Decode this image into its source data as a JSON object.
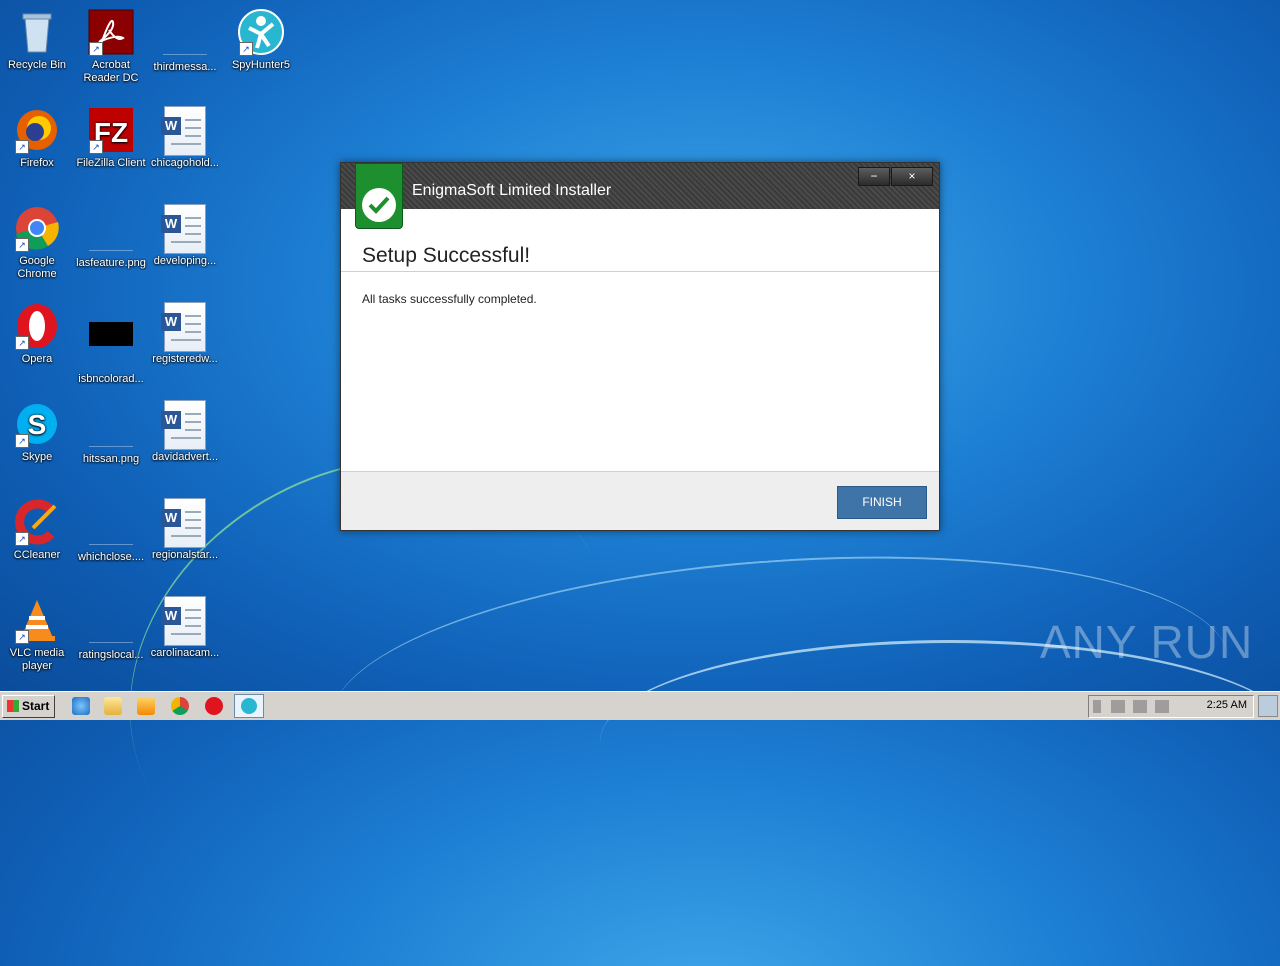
{
  "desktop": {
    "icons": [
      {
        "label": "Recycle Bin"
      },
      {
        "label": "Acrobat Reader DC"
      },
      {
        "label": "thirdmessa..."
      },
      {
        "label": "SpyHunter5"
      },
      {
        "label": "Firefox"
      },
      {
        "label": "FileZilla Client"
      },
      {
        "label": "chicagohold..."
      },
      {
        "label": "Google Chrome"
      },
      {
        "label": "lasfeature.png"
      },
      {
        "label": "developing..."
      },
      {
        "label": "Opera"
      },
      {
        "label": "isbncolorad..."
      },
      {
        "label": "registeredw..."
      },
      {
        "label": "Skype"
      },
      {
        "label": "hitssan.png"
      },
      {
        "label": "davidadvert..."
      },
      {
        "label": "CCleaner"
      },
      {
        "label": "whichclose...."
      },
      {
        "label": "regionalstar..."
      },
      {
        "label": "VLC media player"
      },
      {
        "label": "ratingslocal..."
      },
      {
        "label": "carolinacam..."
      }
    ]
  },
  "installer": {
    "title": "EnigmaSoft Limited Installer",
    "minimize": "−",
    "close": "×",
    "heading": "Setup Successful!",
    "message": "All tasks successfully completed.",
    "finish_label": "FINISH"
  },
  "watermark": "ANY RUN",
  "taskbar": {
    "start_label": "Start",
    "clock": "2:25 AM"
  },
  "colors": {
    "accent": "#3f74a8",
    "logo_green": "#1e8f2f"
  }
}
